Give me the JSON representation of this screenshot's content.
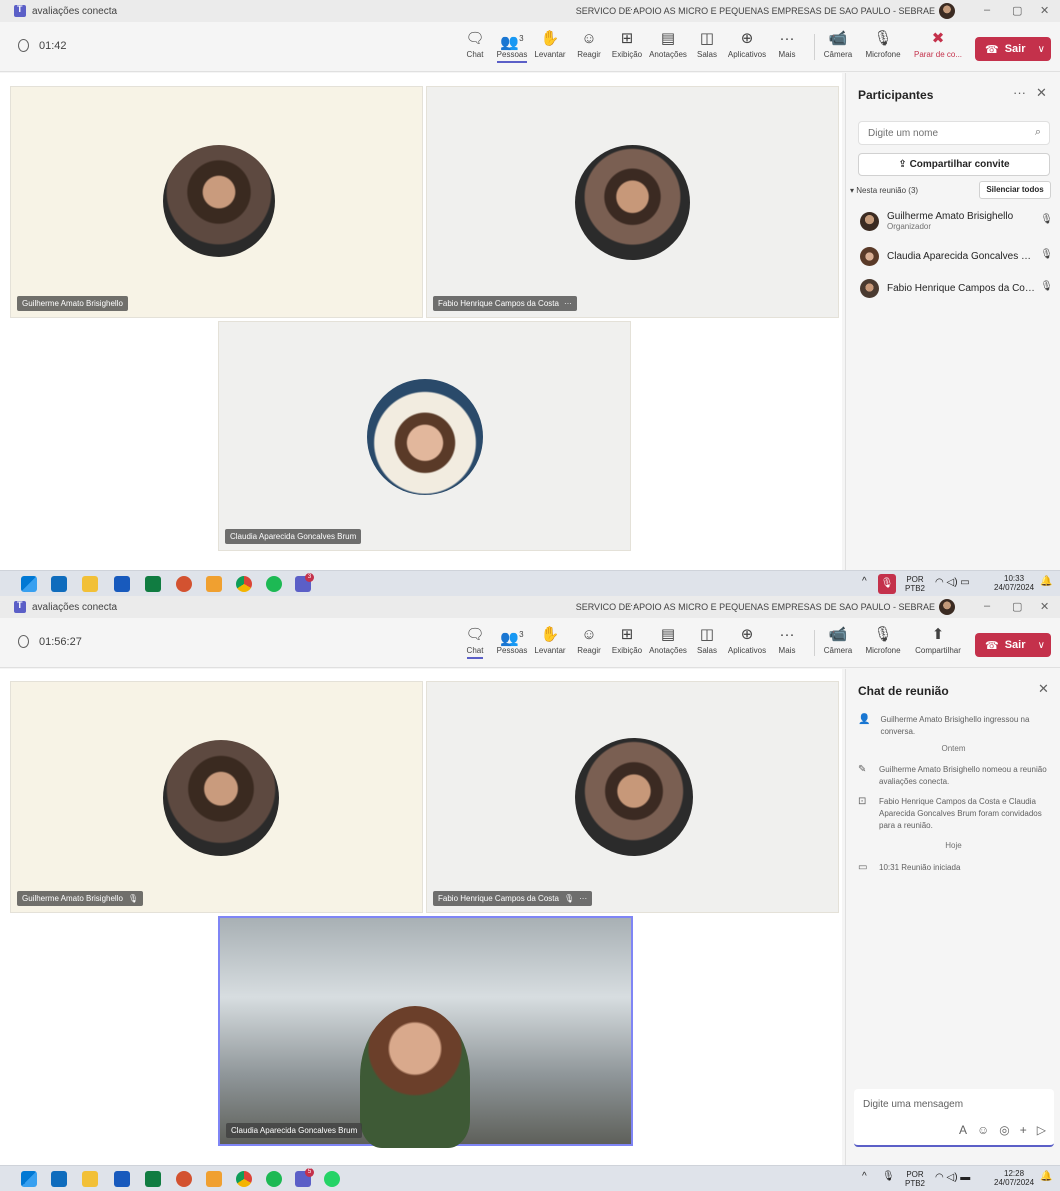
{
  "screen1": {
    "window_title": "avaliações conecta",
    "org": "SERVICO DE APOIO AS MICRO E PEQUENAS EMPRESAS DE SAO PAULO - SEBRAE",
    "more_glyph": "···",
    "timer": "01:42",
    "toolbar": {
      "chat": "Chat",
      "people": "Pessoas",
      "people_count": "3",
      "raise": "Levantar",
      "react": "Reagir",
      "view": "Exibição",
      "notes": "Anotações",
      "rooms": "Salas",
      "apps": "Aplicativos",
      "more": "Mais",
      "camera": "Câmera",
      "mic": "Microfone",
      "stop_share": "Parar de co...",
      "leave": "Sair"
    },
    "tiles": [
      {
        "name": "Guilherme Amato Brisighello"
      },
      {
        "name": "Fabio Henrique Campos da Costa"
      },
      {
        "name": "Claudia Aparecida Goncalves Brum"
      }
    ],
    "panel": {
      "title": "Participantes",
      "search_placeholder": "Digite um nome",
      "share_invite": "Compartilhar convite",
      "section": "Nesta reunião (3)",
      "mute_all": "Silenciar todos",
      "people": [
        {
          "name": "Guilherme Amato Brisighello",
          "role": "Organizador"
        },
        {
          "name": "Claudia Aparecida Goncalves Bru...",
          "role": ""
        },
        {
          "name": "Fabio Henrique Campos da Costa",
          "role": ""
        }
      ]
    },
    "taskbar": {
      "lang": "POR",
      "layout": "PTB2",
      "time": "10:33",
      "date": "24/07/2024",
      "teams_badge": "3"
    }
  },
  "screen2": {
    "window_title": "avaliações conecta",
    "org": "SERVICO DE APOIO AS MICRO E PEQUENAS EMPRESAS DE SAO PAULO - SEBRAE",
    "more_glyph": "···",
    "timer": "01:56:27",
    "toolbar": {
      "chat": "Chat",
      "people": "Pessoas",
      "people_count": "3",
      "raise": "Levantar",
      "react": "Reagir",
      "view": "Exibição",
      "notes": "Anotações",
      "rooms": "Salas",
      "apps": "Aplicativos",
      "more": "Mais",
      "camera": "Câmera",
      "mic": "Microfone",
      "share": "Compartilhar",
      "leave": "Sair"
    },
    "tiles": [
      {
        "name": "Guilherme Amato Brisighello"
      },
      {
        "name": "Fabio Henrique Campos da Costa"
      },
      {
        "name": "Claudia Aparecida Goncalves Brum"
      }
    ],
    "chat": {
      "title": "Chat de reunião",
      "events": [
        {
          "text": "Guilherme Amato Brisighello ingressou na conversa."
        },
        {
          "day": "Ontem"
        },
        {
          "text": "Guilherme Amato Brisighello nomeou a reunião avaliações conecta."
        },
        {
          "text": "Fabio Henrique Campos da Costa e Claudia Aparecida Goncalves Brum foram convidados para a reunião."
        },
        {
          "day": "Hoje"
        },
        {
          "text": "10:31  Reunião iniciada"
        }
      ],
      "placeholder": "Digite uma mensagem"
    },
    "taskbar": {
      "lang": "POR",
      "layout": "PTB2",
      "time": "12:28",
      "date": "24/07/2024",
      "teams_badge": "5"
    }
  },
  "colors": {
    "accent": "#5b5fc7",
    "leave": "#c4314b"
  }
}
